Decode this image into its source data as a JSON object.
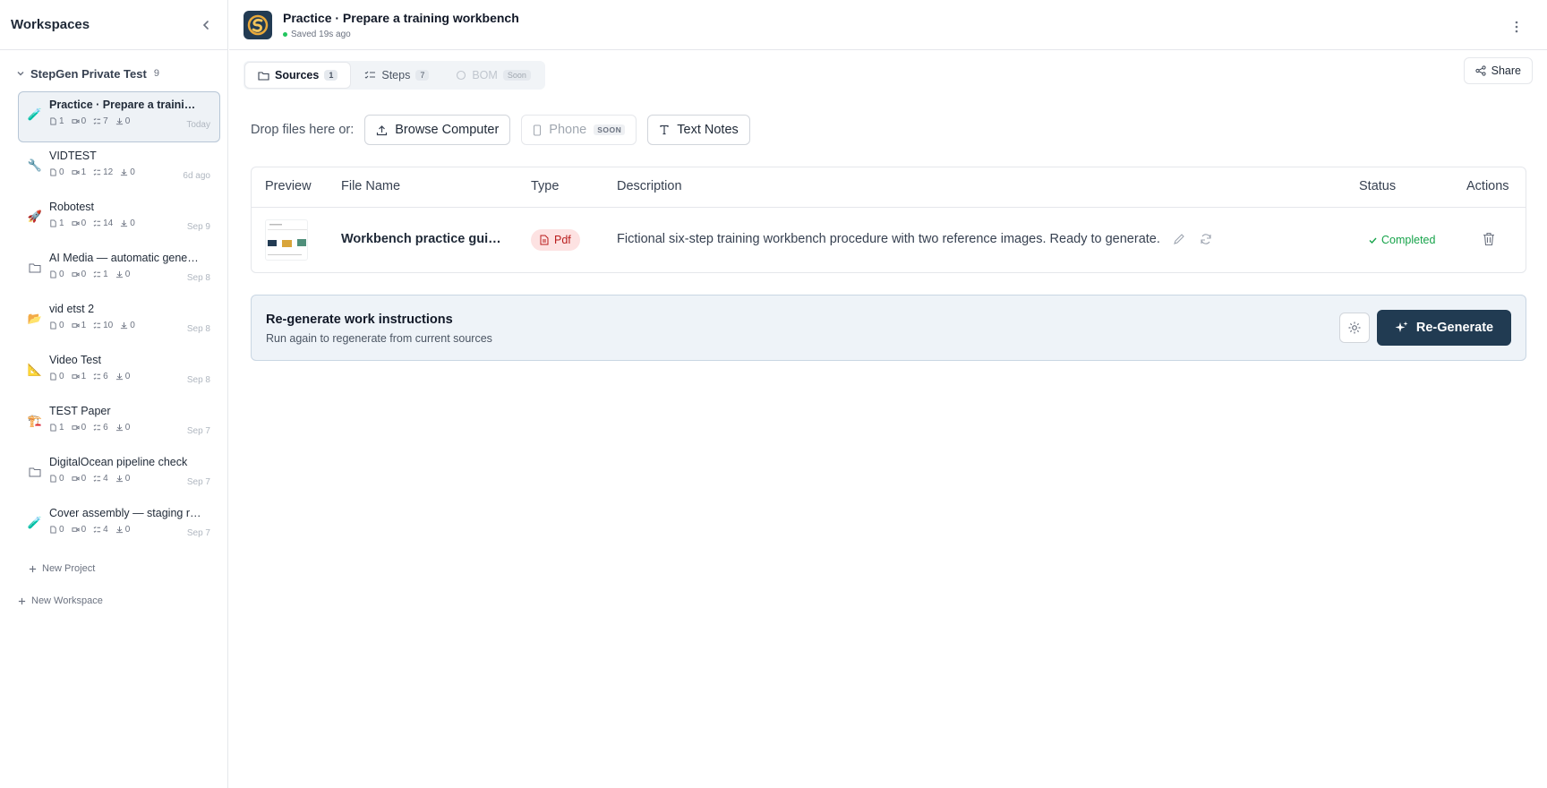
{
  "sidebar": {
    "title": "Workspaces",
    "workspace": {
      "name": "StepGen Private Test",
      "count": "9"
    },
    "projects": [
      {
        "name": "Practice · Prepare a training workbench",
        "icon": "🧪",
        "s1": "1",
        "s2": "0",
        "s3": "7",
        "s4": "0",
        "date": "Today"
      },
      {
        "name": "VIDTEST",
        "icon": "🔧",
        "s1": "0",
        "s2": "1",
        "s3": "12",
        "s4": "0",
        "date": "6d ago"
      },
      {
        "name": "Robotest",
        "icon": "🚀",
        "s1": "1",
        "s2": "0",
        "s3": "14",
        "s4": "0",
        "date": "Sep 9"
      },
      {
        "name": "AI Media — automatic generation",
        "icon": "folder",
        "s1": "0",
        "s2": "0",
        "s3": "1",
        "s4": "0",
        "date": "Sep 8"
      },
      {
        "name": "vid etst 2",
        "icon": "📂",
        "s1": "0",
        "s2": "1",
        "s3": "10",
        "s4": "0",
        "date": "Sep 8"
      },
      {
        "name": "Video Test",
        "icon": "📐",
        "s1": "0",
        "s2": "1",
        "s3": "6",
        "s4": "0",
        "date": "Sep 8"
      },
      {
        "name": "TEST Paper",
        "icon": "🏗️",
        "s1": "1",
        "s2": "0",
        "s3": "6",
        "s4": "0",
        "date": "Sep 7"
      },
      {
        "name": "DigitalOcean pipeline check",
        "icon": "folder",
        "s1": "0",
        "s2": "0",
        "s3": "4",
        "s4": "0",
        "date": "Sep 7"
      },
      {
        "name": "Cover assembly — staging run",
        "icon": "🧪",
        "s1": "0",
        "s2": "0",
        "s3": "4",
        "s4": "0",
        "date": "Sep 7"
      }
    ],
    "new_project": "New Project",
    "new_workspace": "New Workspace"
  },
  "header": {
    "title": "Practice · Prepare a training workbench",
    "saved": "Saved 19s ago"
  },
  "tabs": [
    {
      "label": "Sources",
      "badge": "1"
    },
    {
      "label": "Steps",
      "badge": "7"
    },
    {
      "label": "BOM",
      "badge": "Soon"
    }
  ],
  "share_label": "Share",
  "upload": {
    "drop_label": "Drop files here or:",
    "browse": "Browse Computer",
    "phone": "Phone",
    "phone_tag": "SOON",
    "text_notes": "Text Notes"
  },
  "table": {
    "headers": {
      "preview": "Preview",
      "file_name": "File Name",
      "type": "Type",
      "description": "Description",
      "status": "Status",
      "actions": "Actions"
    },
    "row": {
      "file_name": "Workbench practice guide.pdf",
      "type": "Pdf",
      "description": "Fictional six-step training workbench procedure with two reference images. Ready to generate.",
      "status": "Completed"
    }
  },
  "regenerate": {
    "title": "Re-generate work instructions",
    "subtitle": "Run again to regenerate from current sources",
    "button": "Re-Generate"
  },
  "colors": {
    "accent": "#213b52",
    "success": "#16a34a",
    "pdf_badge_bg": "#fde2e2",
    "pdf_badge_text": "#b91c1c"
  }
}
